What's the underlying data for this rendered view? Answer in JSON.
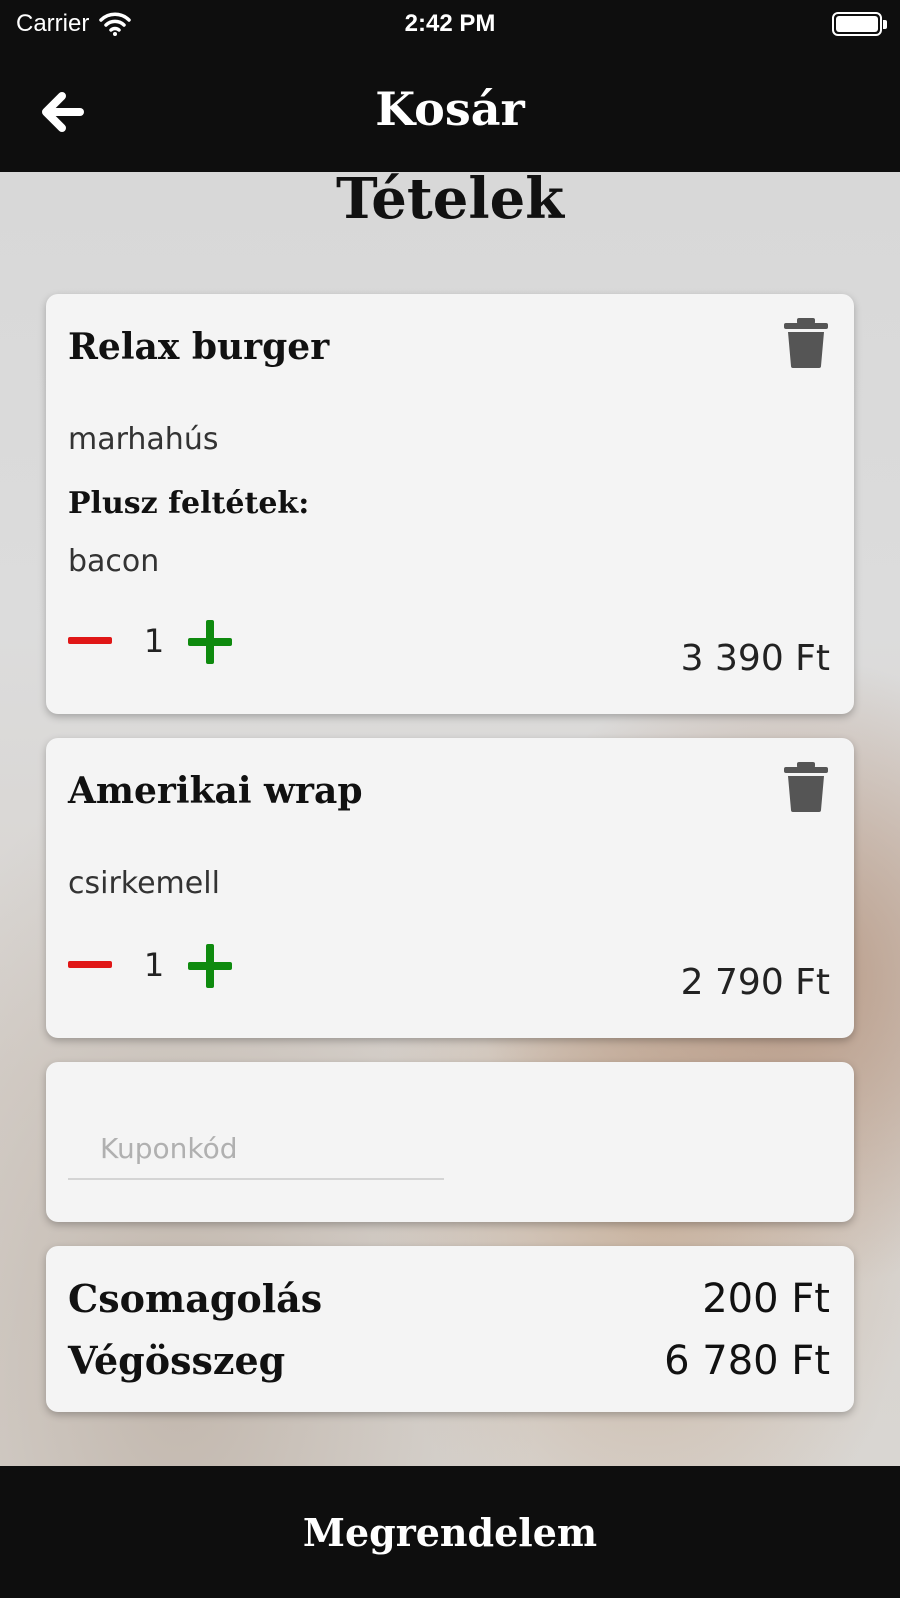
{
  "status_bar": {
    "carrier": "Carrier",
    "time": "2:42 PM",
    "battery_level": 1.0
  },
  "nav": {
    "title": "Kosár",
    "back_icon": "arrow-left-icon"
  },
  "section": {
    "title": "Tételek"
  },
  "items": [
    {
      "name": "Relax burger",
      "meat": "marhahús",
      "extras_label": "Plusz feltétek:",
      "extras": "bacon",
      "quantity": "1",
      "price": "3 390 Ft"
    },
    {
      "name": "Amerikai wrap",
      "meat": "csirkemell",
      "quantity": "1",
      "price": "2 790 Ft"
    }
  ],
  "coupon": {
    "placeholder": "Kuponkód",
    "value": ""
  },
  "summary": {
    "packaging_label": "Csomagolás",
    "packaging_value": "200 Ft",
    "total_label": "Végösszeg",
    "total_value": "6 780 Ft"
  },
  "order_button": {
    "label": "Megrendelem"
  },
  "colors": {
    "minus": "#e01616",
    "plus": "#0e8a0e",
    "bar": "#0e0e0e",
    "card": "#f4f4f4"
  }
}
